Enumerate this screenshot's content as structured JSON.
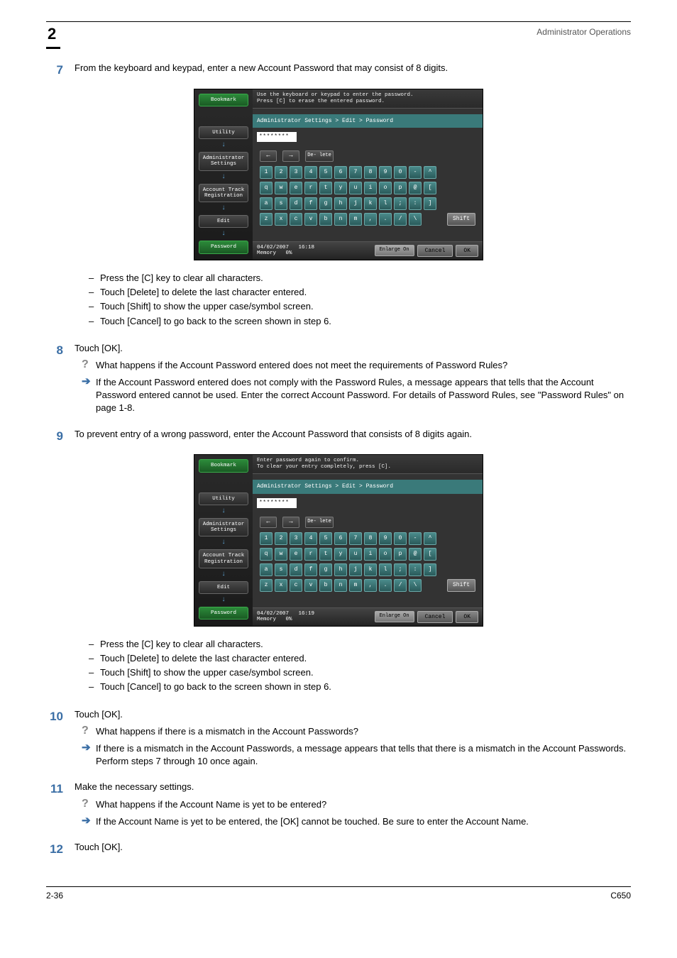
{
  "header": {
    "title": "Administrator Operations",
    "chapter_num": "2"
  },
  "footer": {
    "page": "2-36",
    "doc": "C650"
  },
  "steps": {
    "s7": {
      "num": "7",
      "text": "From the keyboard and keypad, enter a new Account Password that may consist of 8 digits.",
      "bullets": [
        "Press the [C] key to clear all characters.",
        "Touch [Delete] to delete the last character entered.",
        "Touch [Shift] to show the upper case/symbol screen.",
        "Touch [Cancel] to go back to the screen shown in step 6."
      ]
    },
    "s8": {
      "num": "8",
      "text": "Touch [OK].",
      "q": "What happens if the Account Password entered does not meet the requirements of Password Rules?",
      "a": "If the Account Password entered does not comply with the Password Rules, a message appears that tells that the Account Password entered cannot be used. Enter the correct Account Password. For details of Password Rules, see \"Password Rules\" on page 1-8."
    },
    "s9": {
      "num": "9",
      "text": "To prevent entry of a wrong password, enter the Account Password that consists of 8 digits again.",
      "bullets": [
        "Press the [C] key to clear all characters.",
        "Touch [Delete] to delete the last character entered.",
        "Touch [Shift] to show the upper case/symbol screen.",
        "Touch [Cancel] to go back to the screen shown in step 6."
      ]
    },
    "s10": {
      "num": "10",
      "text": "Touch [OK].",
      "q": "What happens if there is a mismatch in the Account Passwords?",
      "a": "If there is a mismatch in the Account Passwords, a message appears that tells that there is a mismatch in the Account Passwords. Perform steps 7 through 10 once again."
    },
    "s11": {
      "num": "11",
      "text": "Make the necessary settings.",
      "q": "What happens if the Account Name is yet to be entered?",
      "a": "If the Account Name is yet to be entered, the [OK] cannot be touched. Be sure to enter the Account Name."
    },
    "s12": {
      "num": "12",
      "text": "Touch [OK]."
    }
  },
  "screen": {
    "a": {
      "instr1": "Use the keyboard or keypad to enter the password.",
      "instr2": "Press [C] to erase the entered password.",
      "crumb": "Administrator Settings > Edit > Password",
      "pw_mask": "********",
      "date": "04/02/2007",
      "time": "16:18",
      "mem": "Memory",
      "mem_pct": "0%"
    },
    "b": {
      "instr1": "Enter password again to confirm.",
      "instr2": "To clear your entry completely, press [C].",
      "crumb": "Administrator Settings > Edit > Password",
      "pw_mask": "********",
      "date": "04/02/2007",
      "time": "16:19",
      "mem": "Memory",
      "mem_pct": "0%"
    },
    "sidebar": {
      "bookmark": "Bookmark",
      "utility": "Utility",
      "admin": "Administrator Settings",
      "track": "Account Track Registration",
      "edit": "Edit",
      "password": "Password"
    },
    "keys": {
      "delete": "De-\nlete",
      "row1": [
        "1",
        "2",
        "3",
        "4",
        "5",
        "6",
        "7",
        "8",
        "9",
        "0",
        "-",
        "^"
      ],
      "row2": [
        "q",
        "w",
        "e",
        "r",
        "t",
        "y",
        "u",
        "i",
        "o",
        "p",
        "@",
        "["
      ],
      "row3": [
        "a",
        "s",
        "d",
        "f",
        "g",
        "h",
        "j",
        "k",
        "l",
        ";",
        ":",
        "]"
      ],
      "row4": [
        "z",
        "x",
        "c",
        "v",
        "b",
        "n",
        "m",
        ",",
        ".",
        "/",
        "\\"
      ],
      "shift": "Shift"
    },
    "buttons": {
      "enlarge": "Enlarge On",
      "cancel": "Cancel",
      "ok": "OK"
    }
  }
}
